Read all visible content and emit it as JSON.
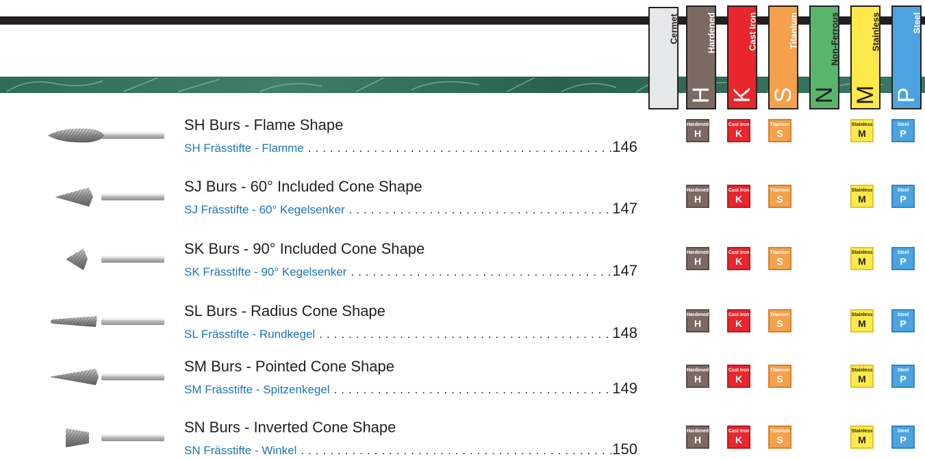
{
  "materials": [
    {
      "key": "cermet",
      "name": "Cermet",
      "letter": "",
      "fill": "#e6e7e8",
      "border": "#231f20",
      "text": "#231f20"
    },
    {
      "key": "hardened",
      "name": "Hardened",
      "letter": "H",
      "fill": "#7b6a63",
      "border": "#231f20",
      "text": "#ffffff"
    },
    {
      "key": "cast-iron",
      "name": "Cast Iron",
      "letter": "K",
      "fill": "#e8262b",
      "border": "#231f20",
      "text": "#ffffff"
    },
    {
      "key": "titanium",
      "name": "Titanium",
      "letter": "S",
      "fill": "#f4a04c",
      "border": "#231f20",
      "text": "#ffffff"
    },
    {
      "key": "non-ferrous",
      "name": "Non-Ferrous",
      "letter": "N",
      "fill": "#59b56c",
      "border": "#231f20",
      "text": "#231f20"
    },
    {
      "key": "stainless",
      "name": "Stainless",
      "letter": "M",
      "fill": "#fde94a",
      "border": "#231f20",
      "text": "#231f20"
    },
    {
      "key": "steel",
      "name": "Steel",
      "letter": "P",
      "fill": "#4da3e0",
      "border": "#231f20",
      "text": "#ffffff"
    }
  ],
  "badges": [
    {
      "name": "Hardened",
      "letter": "H",
      "fill": "#7b6a63",
      "border": "#5a4b45",
      "text": "#ffffff"
    },
    {
      "name": "Cast Iron",
      "letter": "K",
      "fill": "#e8262b",
      "border": "#b51d22",
      "text": "#ffffff"
    },
    {
      "name": "Titanium",
      "letter": "S",
      "fill": "#f4a04c",
      "border": "#d57f2a",
      "text": "#ffffff"
    },
    {
      "name": "Stainless",
      "letter": "M",
      "fill": "#fde94a",
      "border": "#e6c51f",
      "text": "#231f20"
    },
    {
      "name": "Steel",
      "letter": "P",
      "fill": "#4da3e0",
      "border": "#2c86c5",
      "text": "#ffffff"
    }
  ],
  "products": [
    {
      "title": "SH Burs - Flame Shape",
      "subtitle": "SH Frässtifte - Flamme",
      "page": "146",
      "shape": "flame"
    },
    {
      "title": "SJ Burs - 60° Included Cone Shape",
      "subtitle": "SJ Frässtifte - 60° Kegelsenker",
      "page": "147",
      "shape": "cone60"
    },
    {
      "title": "SK Burs - 90° Included Cone Shape",
      "subtitle": "SK Frässtifte - 90° Kegelsenker",
      "page": "147",
      "shape": "cone90"
    },
    {
      "title": "SL Burs - Radius Cone Shape",
      "subtitle": "SL Frässtifte - Rundkegel",
      "page": "148",
      "shape": "radius-cone"
    },
    {
      "title": "SM Burs - Pointed Cone Shape",
      "subtitle": "SM Frässtifte - Spitzenkegel",
      "page": "149",
      "shape": "pointed-cone"
    },
    {
      "title": "SN Burs - Inverted Cone Shape",
      "subtitle": "SN Frässtifte - Winkel",
      "page": "150",
      "shape": "inverted-cone"
    }
  ]
}
